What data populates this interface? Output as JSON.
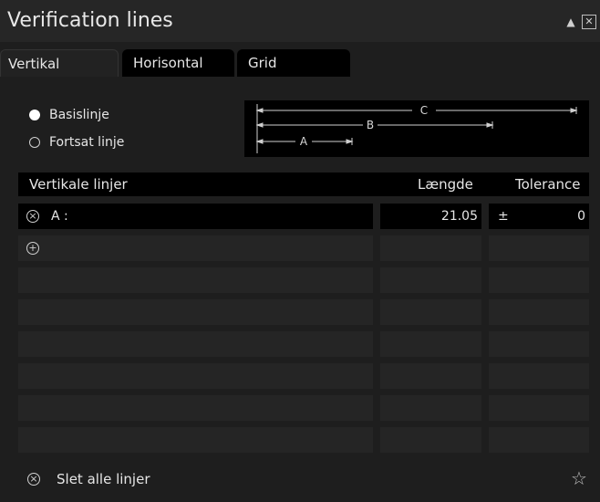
{
  "window": {
    "title": "Verification lines",
    "collapse_icon": "▲",
    "close_icon": "✕"
  },
  "tabs": [
    {
      "label": "Vertikal",
      "active": true
    },
    {
      "label": "Horisontal",
      "active": false
    },
    {
      "label": "Grid",
      "active": false
    }
  ],
  "mode": {
    "options": [
      {
        "label": "Basislinje",
        "selected": true
      },
      {
        "label": "Fortsat linje",
        "selected": false
      }
    ]
  },
  "diagram": {
    "labels": {
      "a": "A",
      "b": "B",
      "c": "C"
    }
  },
  "table": {
    "headers": {
      "name": "Vertikale linjer",
      "length": "Længde",
      "tolerance": "Tolerance"
    },
    "rows": [
      {
        "name": "A :",
        "length": "21.05",
        "tol_sign": "±",
        "tolerance": "0"
      }
    ],
    "empty_rows": 7
  },
  "footer": {
    "delete_all_label": "Slet alle linjer"
  },
  "colors": {
    "background": "#1e1e1e",
    "cell": "#252525",
    "header": "#000000",
    "text": "#e6e6e6"
  },
  "icons": {
    "remove": "remove-circle-icon",
    "add": "add-circle-icon",
    "favorite": "star-icon"
  }
}
